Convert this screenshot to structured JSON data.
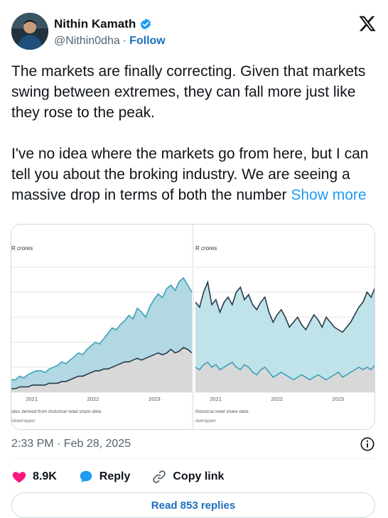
{
  "author": {
    "name": "Nithin Kamath",
    "handle": "@Nithin0dha",
    "separator": "·",
    "follow_label": "Follow"
  },
  "tweet": {
    "paragraph_1": "The markets are finally correcting. Given that markets swing between extremes, they can fall more just like they rose to the peak.",
    "paragraph_2_text": "I've no idea where the markets go from here, but I can tell you about the broking industry. We are seeing a massive drop in terms of both the number",
    "show_more": "Show more",
    "timestamp": "2:33 PM · Feb 28, 2025"
  },
  "actions": {
    "likes": "8.9K",
    "reply_label": "Reply",
    "copy_link_label": "Copy link",
    "read_replies_label": "Read 853 replies"
  },
  "colors": {
    "like": "#f91880",
    "reply": "#1d9bf0",
    "link": "#1d6ec0",
    "verified": "#1d9bf0"
  },
  "chart_data": [
    {
      "type": "area",
      "ylabel": "R crores",
      "x_ticks": [
        "2021",
        "2022",
        "2023"
      ],
      "footnote": "ates derived from historical retail share data.",
      "source": "latawrapper",
      "series": [
        {
          "values": [
            7,
            7,
            9,
            8,
            10,
            11,
            12,
            12,
            11,
            13,
            14,
            15,
            17,
            16,
            18,
            20,
            22,
            21,
            24,
            26,
            28,
            27,
            30,
            33,
            36,
            35,
            38,
            40,
            43,
            41,
            47,
            45,
            42,
            48,
            52,
            55,
            53,
            58,
            60,
            57,
            62,
            64,
            60,
            56
          ]
        },
        {
          "values": [
            2,
            2,
            3,
            3,
            3,
            4,
            4,
            4,
            4,
            5,
            5,
            5,
            6,
            6,
            7,
            8,
            9,
            9,
            10,
            11,
            12,
            12,
            13,
            13,
            14,
            15,
            16,
            17,
            17,
            18,
            19,
            18,
            19,
            20,
            21,
            22,
            21,
            22,
            24,
            22,
            23,
            25,
            24,
            22
          ]
        }
      ]
    },
    {
      "type": "area",
      "ylabel": "R crores",
      "x_ticks": [
        "2021",
        "2022",
        "2023"
      ],
      "footnote": "historical retail share data.",
      "source": "tawrapper",
      "series": [
        {
          "values": [
            36,
            34,
            40,
            44,
            35,
            37,
            32,
            36,
            38,
            35,
            40,
            42,
            37,
            39,
            35,
            33,
            36,
            38,
            32,
            28,
            31,
            33,
            30,
            26,
            28,
            30,
            27,
            25,
            28,
            31,
            29,
            26,
            30,
            28,
            26,
            25,
            24,
            26,
            28,
            31,
            34,
            36,
            40,
            38,
            42
          ]
        },
        {
          "values": [
            10,
            9,
            11,
            12,
            10,
            11,
            9,
            10,
            11,
            12,
            10,
            9,
            11,
            10,
            8,
            7,
            9,
            10,
            8,
            6,
            7,
            8,
            7,
            6,
            5,
            6,
            7,
            6,
            5,
            6,
            7,
            6,
            5,
            6,
            7,
            8,
            6,
            7,
            8,
            9,
            10,
            9,
            10,
            9,
            11
          ]
        }
      ]
    }
  ]
}
